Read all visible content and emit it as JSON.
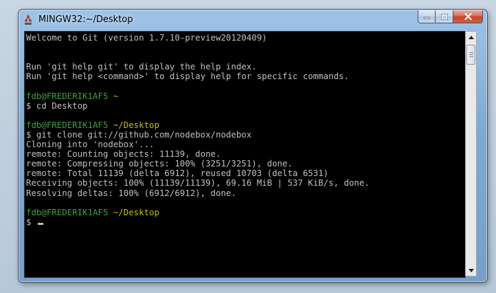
{
  "window": {
    "title": "MINGW32:~/Desktop"
  },
  "icons": {
    "app": "git-bash-icon",
    "minimize": "minimize-icon",
    "maximize": "maximize-icon",
    "close": "close-icon",
    "scroll_up": "scroll-up-arrow-icon",
    "scroll_down": "scroll-down-arrow-icon"
  },
  "colors": {
    "prompt_user": "#3ea03e",
    "prompt_path": "#c0c000",
    "text": "#c0c0c0",
    "background": "#000000"
  },
  "terminal": {
    "welcome": "Welcome to Git (version 1.7.10-preview20120409)",
    "help1": "Run 'git help git' to display the help index.",
    "help2": "Run 'git help <command>' to display help for specific commands.",
    "prompt1_user": "fdb@FREDERIK1AF5",
    "prompt1_path": "~",
    "cmd1": "$ cd Desktop",
    "prompt2_user": "fdb@FREDERIK1AF5",
    "prompt2_path": "~/Desktop",
    "cmd2": "$ git clone git://github.com/nodebox/nodebox",
    "out1": "Cloning into 'nodebox'...",
    "out2": "remote: Counting objects: 11139, done.",
    "out3": "remote: Compressing objects: 100% (3251/3251), done.",
    "out4": "remote: Total 11139 (delta 6912), reused 10703 (delta 6531)",
    "out5": "Receiving objects: 100% (11139/11139), 69.16 MiB | 537 KiB/s, done.",
    "out6": "Resolving deltas: 100% (6912/6912), done.",
    "prompt3_user": "fdb@FREDERIK1AF5",
    "prompt3_path": "~/Desktop",
    "prompt_symbol": "$"
  }
}
